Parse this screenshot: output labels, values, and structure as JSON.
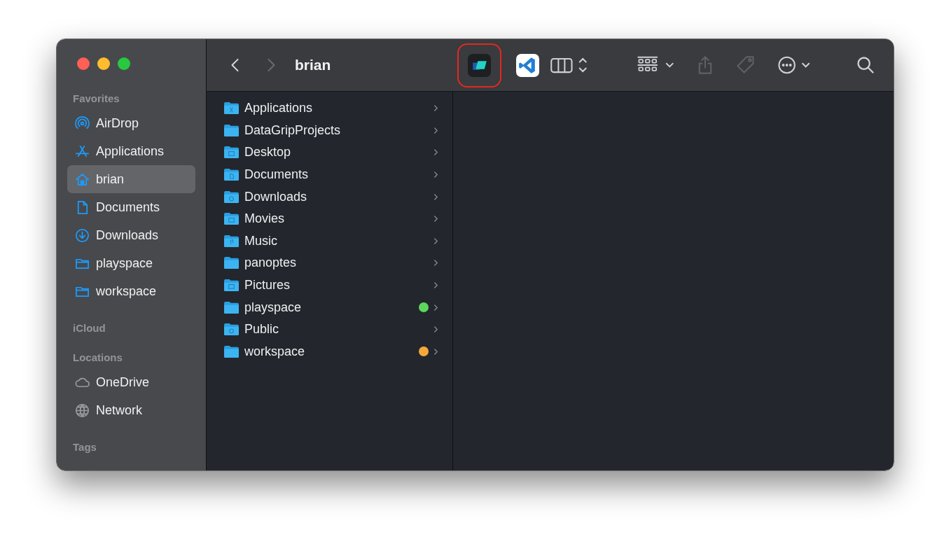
{
  "window": {
    "title": "brian"
  },
  "toolbar": {
    "back_disabled": false,
    "forward_disabled": true,
    "apps": [
      {
        "kind": "cloud-app",
        "highlighted": true
      },
      {
        "kind": "code-editor",
        "highlighted": false
      }
    ],
    "tools": [
      {
        "kind": "columns",
        "disabled": false
      },
      {
        "kind": "group",
        "disabled": false
      },
      {
        "kind": "share",
        "disabled": true
      },
      {
        "kind": "tag",
        "disabled": true
      },
      {
        "kind": "more",
        "disabled": false
      },
      {
        "kind": "search",
        "disabled": false
      }
    ]
  },
  "sidebar": {
    "sections": [
      {
        "title": "Favorites",
        "items": [
          {
            "label": "AirDrop",
            "kind": "airdrop",
            "selected": false
          },
          {
            "label": "Applications",
            "kind": "apps",
            "selected": false
          },
          {
            "label": "brian",
            "kind": "home",
            "selected": true
          },
          {
            "label": "Documents",
            "kind": "document",
            "selected": false
          },
          {
            "label": "Downloads",
            "kind": "download",
            "selected": false
          },
          {
            "label": "playspace",
            "kind": "folder",
            "selected": false
          },
          {
            "label": "workspace",
            "kind": "folder",
            "selected": false
          }
        ]
      },
      {
        "title": "iCloud"
      },
      {
        "title": "Locations",
        "items": [
          {
            "label": "OneDrive",
            "kind": "cloud",
            "selected": false
          },
          {
            "label": "Network",
            "kind": "globe",
            "selected": false
          }
        ]
      },
      {
        "title": "Tags"
      }
    ]
  },
  "column": {
    "items": [
      {
        "name": "Applications",
        "kind": "apps"
      },
      {
        "name": "DataGripProjects",
        "kind": "plain"
      },
      {
        "name": "Desktop",
        "kind": "desktop"
      },
      {
        "name": "Documents",
        "kind": "doc"
      },
      {
        "name": "Downloads",
        "kind": "download"
      },
      {
        "name": "Movies",
        "kind": "film"
      },
      {
        "name": "Music",
        "kind": "music"
      },
      {
        "name": "panoptes",
        "kind": "plain"
      },
      {
        "name": "Pictures",
        "kind": "picture"
      },
      {
        "name": "playspace",
        "kind": "plain",
        "color": "#5cd65c"
      },
      {
        "name": "Public",
        "kind": "public"
      },
      {
        "name": "workspace",
        "kind": "plain",
        "color": "#f5a83a"
      }
    ]
  }
}
